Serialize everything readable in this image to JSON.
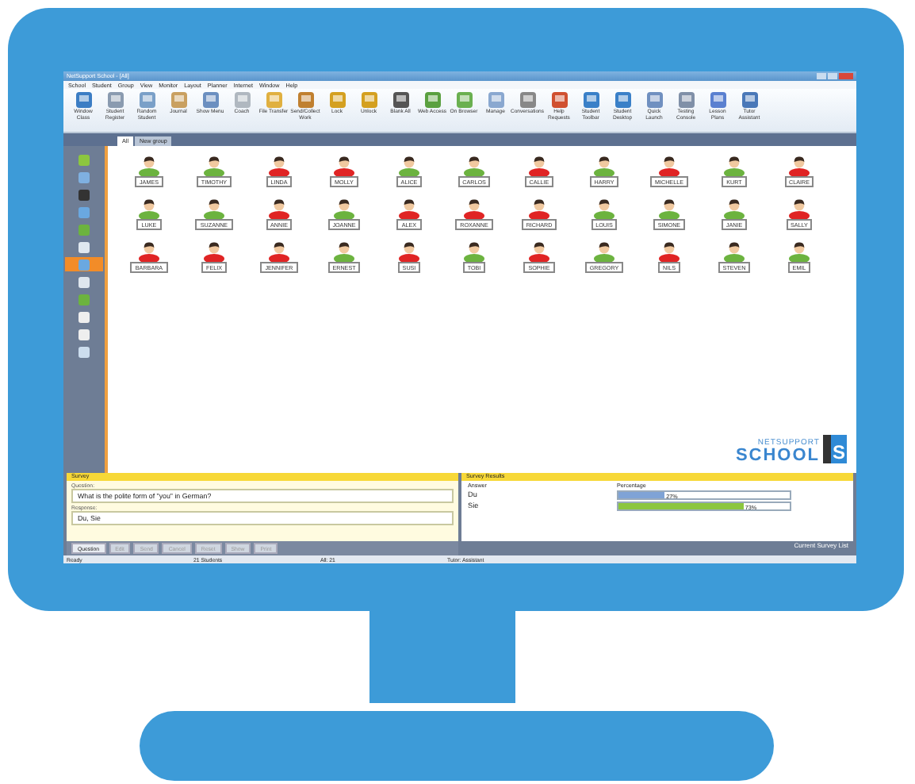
{
  "window": {
    "title": "NetSupport School - [All]"
  },
  "menu": [
    "School",
    "Student",
    "Group",
    "View",
    "Monitor",
    "Layout",
    "Planner",
    "Internet",
    "Window",
    "Help"
  ],
  "toolbar": [
    {
      "label": "Window Class"
    },
    {
      "label": "Student Register"
    },
    {
      "label": "Random Student"
    },
    {
      "label": "Journal"
    },
    {
      "label": "Show Menu"
    },
    {
      "label": "Coach"
    },
    {
      "label": "File Transfer"
    },
    {
      "label": "Send/Collect Work"
    },
    {
      "label": "Lock"
    },
    {
      "label": "Unlock"
    },
    {
      "label": "Blank All"
    },
    {
      "label": "Web Access"
    },
    {
      "label": "On Browser"
    },
    {
      "label": "Manage"
    },
    {
      "label": "Conversations"
    },
    {
      "label": "Help Requests"
    },
    {
      "label": "Student Toolbar"
    },
    {
      "label": "Student Desktop"
    },
    {
      "label": "Quick Launch"
    },
    {
      "label": "Testing Console"
    },
    {
      "label": "Lesson Plans"
    },
    {
      "label": "Tutor Assistant"
    }
  ],
  "tabs": [
    {
      "label": "All",
      "selected": true
    },
    {
      "label": "New group",
      "selected": false
    }
  ],
  "sidebar": {
    "items": [
      {
        "selected": false
      },
      {
        "selected": false
      },
      {
        "selected": false
      },
      {
        "selected": false
      },
      {
        "selected": false
      },
      {
        "selected": false
      },
      {
        "selected": true
      },
      {
        "selected": false
      },
      {
        "selected": false
      },
      {
        "selected": false
      },
      {
        "selected": false
      },
      {
        "selected": false
      }
    ]
  },
  "students": [
    {
      "name": "JAMES",
      "color": "#6cb33f"
    },
    {
      "name": "TIMOTHY",
      "color": "#6cb33f"
    },
    {
      "name": "LINDA",
      "color": "#e02424"
    },
    {
      "name": "MOLLY",
      "color": "#e02424"
    },
    {
      "name": "ALICE",
      "color": "#6cb33f"
    },
    {
      "name": "CARLOS",
      "color": "#6cb33f"
    },
    {
      "name": "CALLIE",
      "color": "#e02424"
    },
    {
      "name": "HARRY",
      "color": "#6cb33f"
    },
    {
      "name": "MICHELLE",
      "color": "#e02424"
    },
    {
      "name": "KURT",
      "color": "#6cb33f"
    },
    {
      "name": "CLAIRE",
      "color": "#e02424"
    },
    {
      "name": "LUKE",
      "color": "#6cb33f"
    },
    {
      "name": "SUZANNE",
      "color": "#6cb33f"
    },
    {
      "name": "ANNIE",
      "color": "#e02424"
    },
    {
      "name": "JOANNE",
      "color": "#6cb33f"
    },
    {
      "name": "ALEX",
      "color": "#e02424"
    },
    {
      "name": "ROXANNE",
      "color": "#e02424"
    },
    {
      "name": "RICHARD",
      "color": "#e02424"
    },
    {
      "name": "LOUIS",
      "color": "#6cb33f"
    },
    {
      "name": "SIMONE",
      "color": "#6cb33f"
    },
    {
      "name": "JANIE",
      "color": "#6cb33f"
    },
    {
      "name": "SALLY",
      "color": "#e02424"
    },
    {
      "name": "BARBARA",
      "color": "#e02424"
    },
    {
      "name": "FELIX",
      "color": "#e02424"
    },
    {
      "name": "JENNIFER",
      "color": "#e02424"
    },
    {
      "name": "ERNEST",
      "color": "#6cb33f"
    },
    {
      "name": "SUSI",
      "color": "#e02424"
    },
    {
      "name": "TOBI",
      "color": "#6cb33f"
    },
    {
      "name": "SOPHIE",
      "color": "#e02424"
    },
    {
      "name": "GREGORY",
      "color": "#6cb33f"
    },
    {
      "name": "NILS",
      "color": "#e02424"
    },
    {
      "name": "STEVEN",
      "color": "#6cb33f"
    },
    {
      "name": "EMIL",
      "color": "#6cb33f"
    }
  ],
  "logo": {
    "line_1": "NETSUPPORT",
    "line_2": "SCHOOL",
    "mark": "S"
  },
  "survey": {
    "title": "Survey",
    "question_label": "Question:",
    "question": "What is the polite form of \"you\" in German?",
    "response_label": "Response:",
    "response": "Du, Sie",
    "buttons": [
      {
        "label": "Question",
        "disabled": false
      },
      {
        "label": "Edit",
        "disabled": true
      },
      {
        "label": "Send",
        "disabled": true
      },
      {
        "label": "Cancel",
        "disabled": true
      },
      {
        "label": "Reset",
        "disabled": true
      },
      {
        "label": "Show",
        "disabled": true
      },
      {
        "label": "Print",
        "disabled": true
      }
    ]
  },
  "results": {
    "title": "Survey Results",
    "columns": [
      "Answer",
      "Percentage"
    ],
    "rows": [
      {
        "answer": "Du",
        "level": 0.27,
        "reading": "27%",
        "color": "#7fa3d6"
      },
      {
        "answer": "Sie",
        "level": 0.73,
        "reading": "73%",
        "color": "#8cc63f"
      }
    ],
    "footer": "Current Survey List"
  },
  "status_bar": [
    "Ready",
    "21 Students",
    "All: 21",
    "Tutor: Assistant"
  ]
}
